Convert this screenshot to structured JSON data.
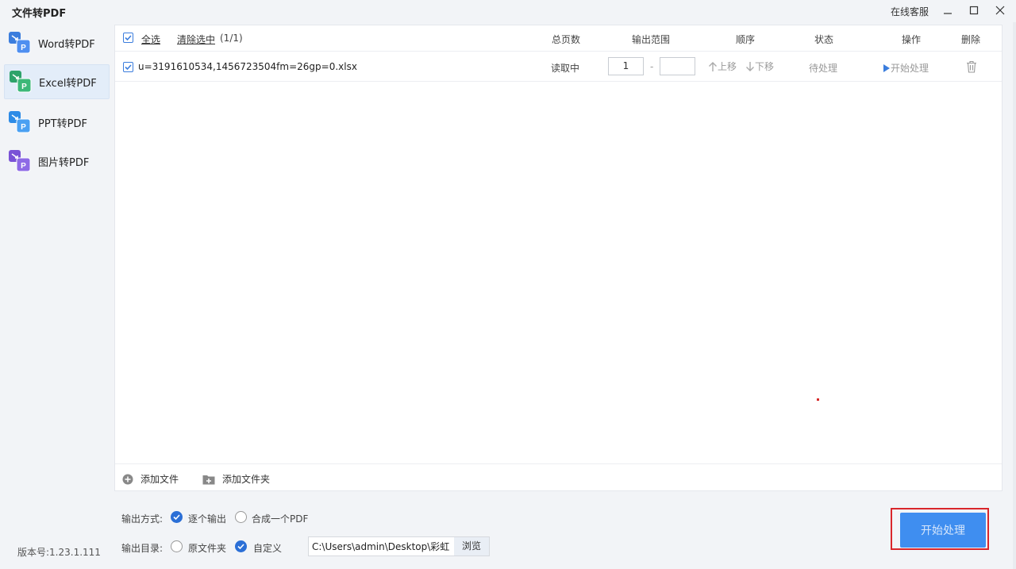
{
  "app": {
    "title": "文件转PDF",
    "online_service": "在线客服",
    "version": "版本号:1.23.1.111"
  },
  "sidebar": {
    "items": [
      {
        "label": "Word转PDF",
        "icon": "word-to-pdf-icon",
        "color": "#3b7ddd",
        "active": false
      },
      {
        "label": "Excel转PDF",
        "icon": "excel-to-pdf-icon",
        "color": "#2ea36a",
        "active": true
      },
      {
        "label": "PPT转PDF",
        "icon": "ppt-to-pdf-icon",
        "color": "#2d8be6",
        "active": false
      },
      {
        "label": "图片转PDF",
        "icon": "image-to-pdf-icon",
        "color": "#7a52d6",
        "active": false
      }
    ]
  },
  "table": {
    "select_all": "全选",
    "clear_selection": "清除选中",
    "selection_count": "(1/1)",
    "headers": {
      "total_pages": "总页数",
      "output_range": "输出范围",
      "order": "顺序",
      "status": "状态",
      "action": "操作",
      "delete": "删除"
    },
    "rows": [
      {
        "filename": "u=3191610534,1456723504fm=26gp=0.xlsx",
        "total_pages": "读取中",
        "range_from": "1",
        "range_sep": "-",
        "range_to": "",
        "move_up": "上移",
        "move_down": "下移",
        "status": "待处理",
        "action": "开始处理"
      }
    ]
  },
  "footer": {
    "add_file": "添加文件",
    "add_folder": "添加文件夹"
  },
  "options": {
    "output_mode_label": "输出方式:",
    "mode_individual": "逐个输出",
    "mode_merge": "合成一个PDF",
    "output_dir_label": "输出目录:",
    "dir_original": "原文件夹",
    "dir_custom": "自定义",
    "path_value": "C:\\Users\\admin\\Desktop\\彩虹",
    "browse": "浏览"
  },
  "start_button": "开始处理",
  "colors": {
    "accent": "#3b7ddd",
    "start_button": "#3f8ef0",
    "highlight_border": "#d9262b"
  }
}
